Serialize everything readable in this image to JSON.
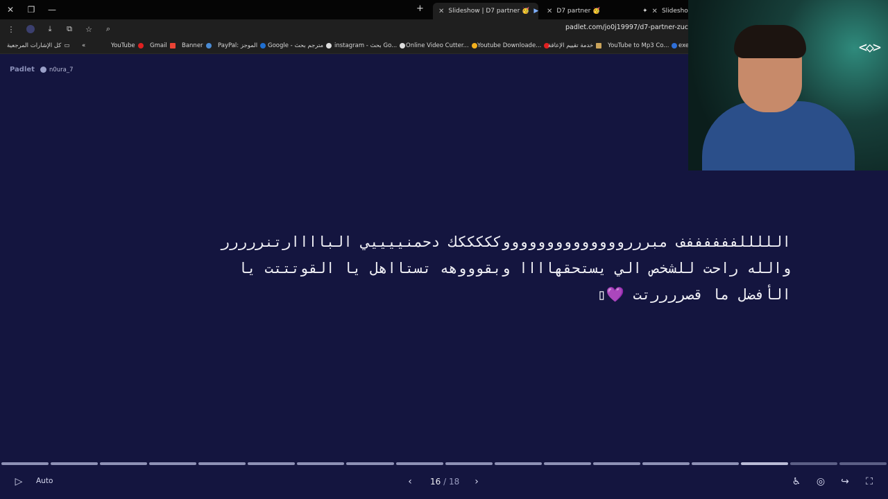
{
  "browser": {
    "tabs": [
      {
        "label": "Slideshow | D7 partner 🥳",
        "active": true
      },
      {
        "label": "D7 partner 🥳",
        "active": false
      },
      {
        "label": "Slideshow",
        "active": false
      }
    ],
    "url": "padlet.com/jo0j19997/d7-partner-zuc",
    "bookmarks": [
      "كل الإشارات المرجعية",
      "YouTube",
      "Gmail",
      "Banner",
      "PayPal: الموجز",
      "Google - مترجم بحث",
      "instagram - بحث Go...",
      "Online Video Cutter...",
      "Youtube Downloade...",
      "خدمة تقييم الإعاقة",
      "YouTube to Mp3 Co...",
      "exe"
    ]
  },
  "padlet": {
    "brand": "Padlet",
    "user": "n0ura_7"
  },
  "post": {
    "line1": "الللللففففففف مبرررووووووووووووووكككككك دحمنييييي الباااارتنررررر",
    "line2": "والله راحت للشخص الي يستحقهاااا وبقوووهه تستااهل يا القوتتتت يا",
    "line3": "الأفضل ما قصررررتت",
    "emoji": "💜"
  },
  "slideshow": {
    "current": "16",
    "total": "18",
    "auto_label": "Auto",
    "progress_current": 16,
    "progress_total": 18
  }
}
